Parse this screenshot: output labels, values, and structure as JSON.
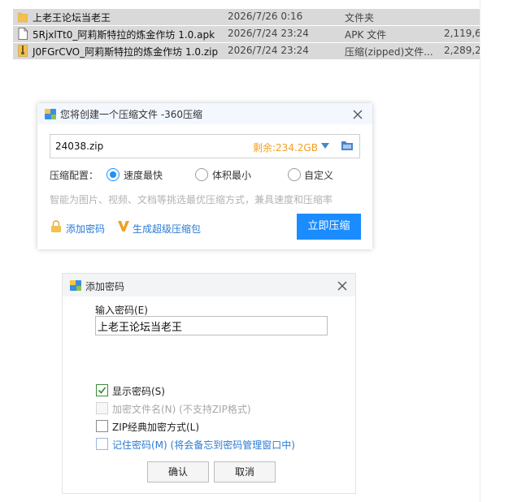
{
  "files": [
    {
      "name": "上老王论坛当老王",
      "date": "2026/7/26 0:16",
      "type": "文件夹",
      "size": "",
      "icon": "folder-icon"
    },
    {
      "name": "5RjxlTt0_阿莉斯特拉的炼金作坊 1.0.apk",
      "date": "2026/7/24 23:24",
      "type": "APK 文件",
      "size": "2,119,6",
      "icon": "apk-file-icon"
    },
    {
      "name": "J0FGrCVO_阿莉斯特拉的炼金作坊 1.0.zip",
      "date": "2026/7/24 23:24",
      "type": "压缩(zipped)文件...",
      "size": "2,289,2",
      "icon": "zip-file-icon"
    }
  ],
  "compress_dialog": {
    "title": "您将创建一个压缩文件 -360压缩",
    "filename": "24038.zip",
    "free_space": "剩余:234.2GB",
    "config_label": "压缩配置：",
    "options": [
      {
        "label": "速度最快",
        "selected": true
      },
      {
        "label": "体积最小",
        "selected": false
      },
      {
        "label": "自定义",
        "selected": false
      }
    ],
    "hint": "智能为图片、视频、文档等挑选最优压缩方式，兼具速度和压缩率",
    "add_password": "添加密码",
    "super_package": "生成超级压缩包",
    "compress_button": "立即压缩",
    "accent_color": "#1a8cff"
  },
  "password_dialog": {
    "title": "添加密码",
    "input_label": "输入密码(E)",
    "password_value": "上老王论坛当老王",
    "checkboxes": [
      {
        "label": "显示密码(S)",
        "checked": true,
        "enabled": true
      },
      {
        "label": "加密文件名(N) (不支持ZIP格式)",
        "checked": false,
        "enabled": false
      },
      {
        "label": "ZIP经典加密方式(L)",
        "checked": false,
        "enabled": true
      },
      {
        "label": "记住密码(M) (将会备忘到密码管理窗口中)",
        "checked": false,
        "enabled": true
      }
    ],
    "ok_button": "确认",
    "cancel_button": "取消"
  }
}
